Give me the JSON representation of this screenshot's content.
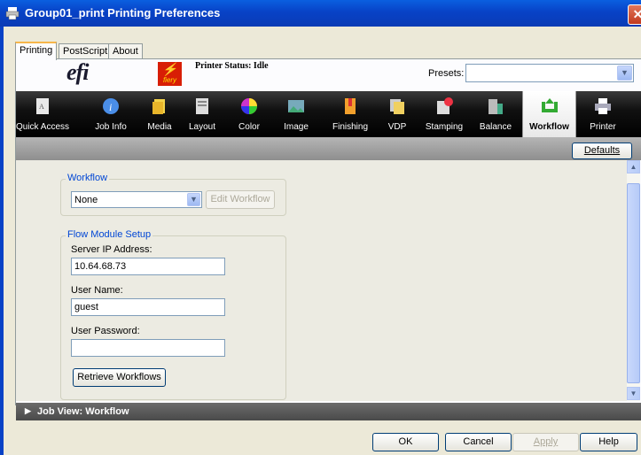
{
  "window": {
    "title": "Group01_print Printing Preferences",
    "close_glyph": "✕"
  },
  "tabs": [
    {
      "label": "Printing"
    },
    {
      "label": "PostScript"
    },
    {
      "label": "About"
    }
  ],
  "header": {
    "logo_text": "efi",
    "fiery_text": "fiery",
    "printer_status": "Printer Status: Idle",
    "presets_label": "Presets:",
    "presets_value": ""
  },
  "toolbar": {
    "items": [
      {
        "label": "Quick Access",
        "icon": "quick-access-icon"
      },
      {
        "label": "Job Info",
        "icon": "info-icon"
      },
      {
        "label": "Media",
        "icon": "media-icon"
      },
      {
        "label": "Layout",
        "icon": "layout-icon"
      },
      {
        "label": "Color",
        "icon": "color-wheel-icon"
      },
      {
        "label": "Image",
        "icon": "image-icon"
      },
      {
        "label": "Finishing",
        "icon": "finishing-icon"
      },
      {
        "label": "VDP",
        "icon": "vdp-icon"
      },
      {
        "label": "Stamping",
        "icon": "stamping-icon"
      },
      {
        "label": "Balance",
        "icon": "balance-icon"
      },
      {
        "label": "Workflow",
        "icon": "workflow-icon",
        "active": true
      },
      {
        "label": "Printer",
        "icon": "printer-icon"
      }
    ],
    "accent": "#000000"
  },
  "defaults_label": "Defaults",
  "workflow": {
    "legend": "Workflow",
    "selected": "None",
    "edit_label": "Edit Workflow"
  },
  "flow_module": {
    "legend": "Flow Module Setup",
    "server_label": "Server IP Address:",
    "server_value": "10.64.68.73",
    "user_label": "User Name:",
    "user_value": "guest",
    "password_label": "User Password:",
    "password_value": "",
    "retrieve_label": "Retrieve Workflows"
  },
  "job_view": {
    "label": "Job View: Workflow"
  },
  "buttons": {
    "ok": "OK",
    "cancel": "Cancel",
    "apply": "Apply",
    "help": "Help"
  },
  "colors": {
    "legend_blue": "#0046d5",
    "title_blue": "#0842c6",
    "fiery_red": "#d81e05"
  }
}
